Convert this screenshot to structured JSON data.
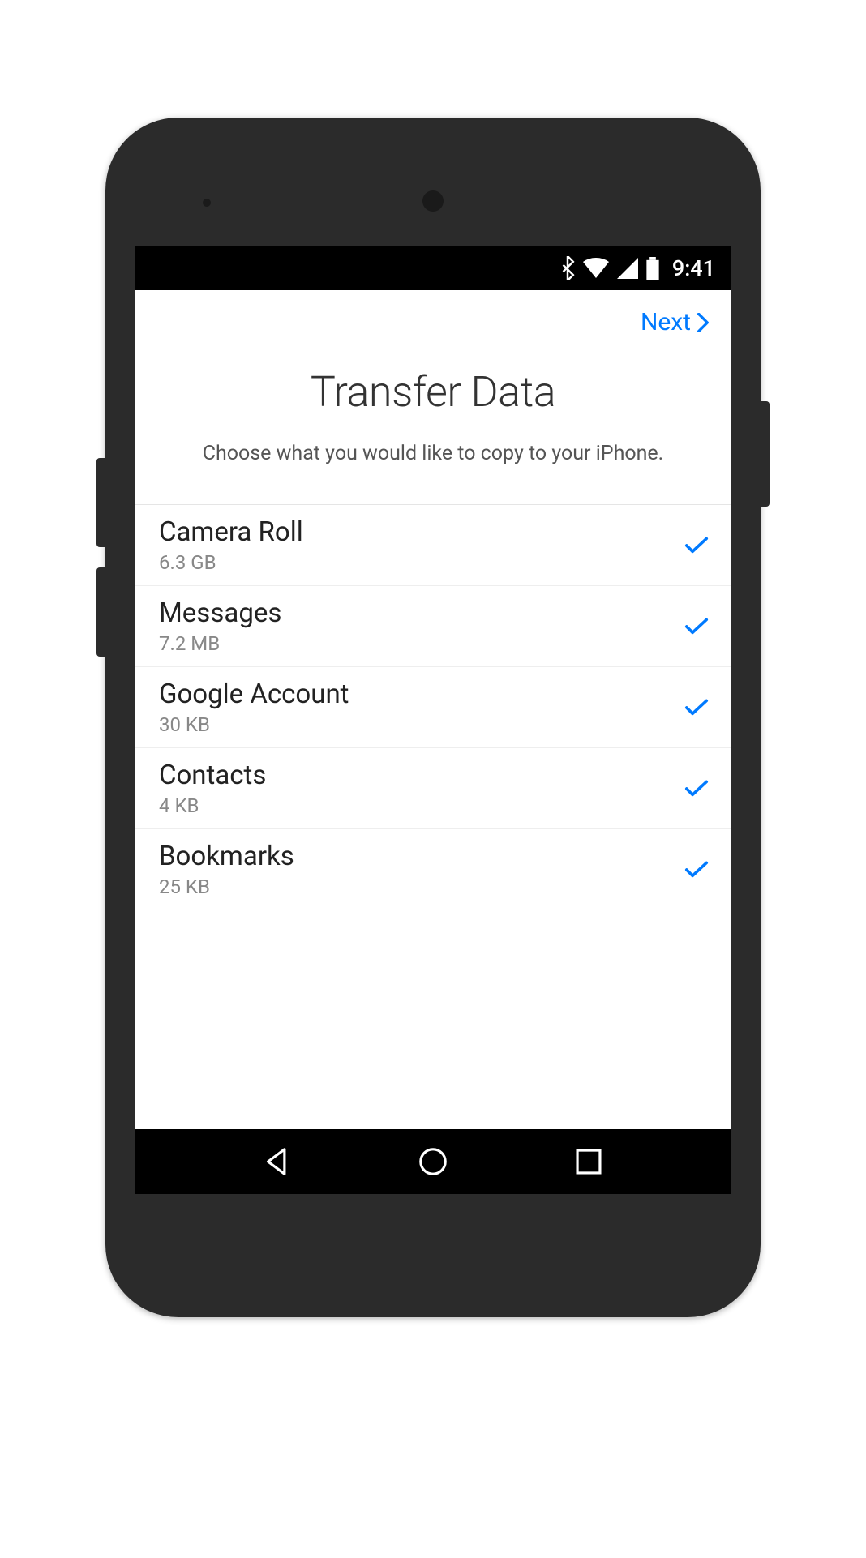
{
  "status_bar": {
    "time": "9:41"
  },
  "nav": {
    "next_label": "Next"
  },
  "header": {
    "title": "Transfer Data",
    "subtitle": "Choose what you would like to copy to your iPhone."
  },
  "items": [
    {
      "label": "Camera Roll",
      "size": "6.3 GB"
    },
    {
      "label": "Messages",
      "size": "7.2 MB"
    },
    {
      "label": "Google Account",
      "size": "30 KB"
    },
    {
      "label": "Contacts",
      "size": "4 KB"
    },
    {
      "label": "Bookmarks",
      "size": "25 KB"
    }
  ],
  "colors": {
    "accent": "#007aff"
  }
}
